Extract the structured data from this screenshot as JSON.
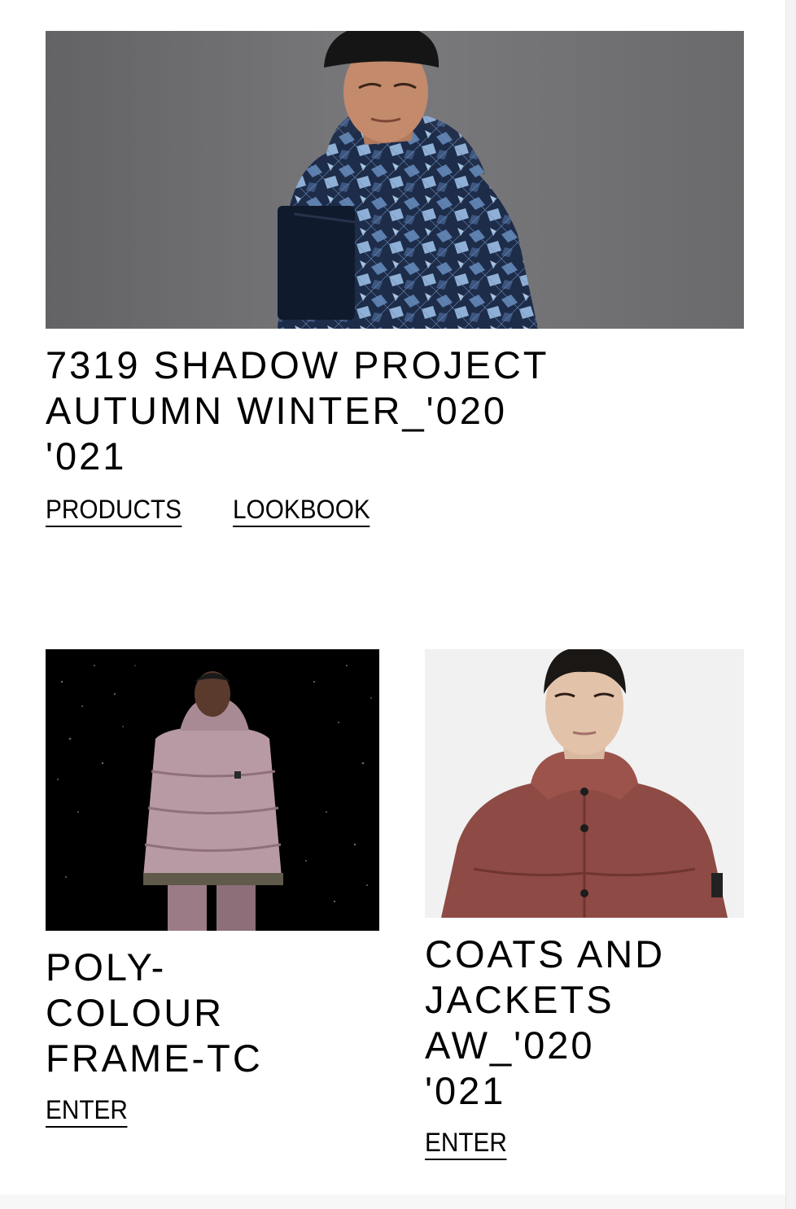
{
  "hero": {
    "title": "7319 SHADOW PROJECT\nAUTUMN WINTER_'020\n'021",
    "links": {
      "products": "PRODUCTS",
      "lookbook": "LOOKBOOK"
    }
  },
  "cards": [
    {
      "title": "POLY-\nCOLOUR\nFRAME-TC",
      "link": "ENTER"
    },
    {
      "title": "COATS AND\nJACKETS\nAW_'020\n'021",
      "link": "ENTER"
    }
  ],
  "colors": {
    "text": "#000000",
    "background": "#ffffff",
    "hero_backdrop": "#6a6a6c",
    "card1_backdrop": "#000000",
    "card2_backdrop": "#f1f1f1"
  }
}
